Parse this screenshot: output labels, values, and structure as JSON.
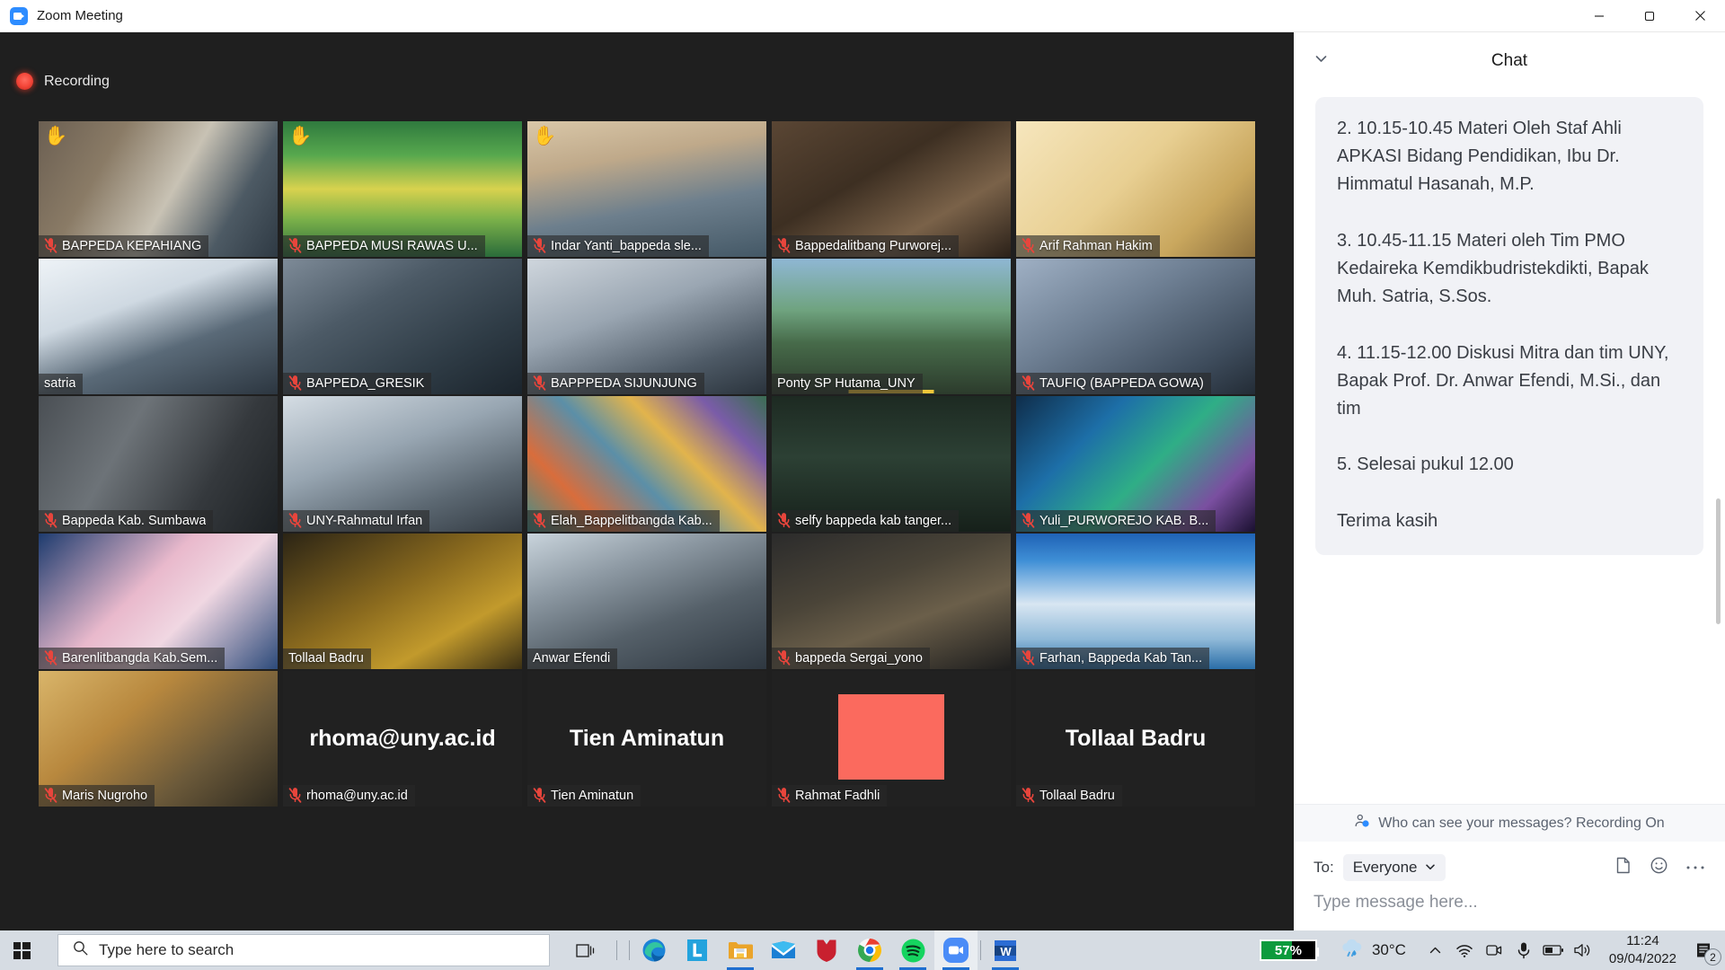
{
  "window": {
    "title": "Zoom Meeting",
    "app_icon": "zoom-camera-icon",
    "minimize_label": "─",
    "maximize_label": "❐",
    "close_label": "✕"
  },
  "meeting": {
    "recording_label": "Recording",
    "participants": [
      {
        "name": "BAPPEDA KEPAHIANG",
        "muted": true,
        "hand": true,
        "raised": "✋",
        "active": false,
        "speaking": false,
        "bg": "linear-gradient(120deg,#6b5f52 0%,#8a7b66 28%,#c8c2b4 55%,#4d5a64 78%,#2f3a44 100%)",
        "text": "",
        "redblock": false
      },
      {
        "name": "BAPPEDA MUSI RAWAS U...",
        "muted": true,
        "hand": true,
        "raised": "✋",
        "active": false,
        "speaking": false,
        "bg": "linear-gradient(180deg,#2f7a3e 0%,#57a84e 25%,#d8d24e 50%,#7cb24a 72%,#2a6b3a 100%)",
        "text": "",
        "redblock": false
      },
      {
        "name": "Indar Yanti_bappeda sle...",
        "muted": true,
        "hand": true,
        "raised": "✋",
        "active": false,
        "speaking": false,
        "bg": "linear-gradient(170deg,#d9c7a8 0%,#bfa98a 30%,#6d7f8d 62%,#445866 100%)",
        "text": "",
        "redblock": false
      },
      {
        "name": "Bappedalitbang Purworej...",
        "muted": true,
        "hand": false,
        "raised": "",
        "active": false,
        "speaking": false,
        "bg": "linear-gradient(150deg,#5a4634 0%,#3d2f22 40%,#7a6249 70%,#2b2119 100%)",
        "text": "",
        "redblock": false
      },
      {
        "name": "Arif Rahman Hakim",
        "muted": true,
        "hand": false,
        "raised": "",
        "active": false,
        "speaking": false,
        "bg": "linear-gradient(135deg,#f6e6bd 0%,#e8cf92 45%,#c9a75e 75%,#8c6f3c 100%)",
        "text": "",
        "redblock": false
      },
      {
        "name": "satria",
        "muted": false,
        "hand": false,
        "raised": "",
        "active": false,
        "speaking": false,
        "bg": "linear-gradient(160deg,#eef3f7 0%,#cfd9e2 35%,#5a6a78 62%,#2c3640 100%)",
        "text": "",
        "redblock": false
      },
      {
        "name": "BAPPEDA_GRESIK",
        "muted": true,
        "hand": false,
        "raised": "",
        "active": false,
        "speaking": false,
        "bg": "linear-gradient(150deg,#7e8b98 0%,#4c5a66 35%,#2f3c46 70%,#1b242c 100%)",
        "text": "",
        "redblock": false
      },
      {
        "name": "BAPPPEDA SIJUNJUNG",
        "muted": true,
        "hand": false,
        "raised": "",
        "active": false,
        "speaking": false,
        "bg": "linear-gradient(160deg,#cfd6dd 0%,#9aa6b2 40%,#4e5a66 75%,#2a333c 100%)",
        "text": "",
        "redblock": false
      },
      {
        "name": "Ponty SP Hutama_UNY",
        "muted": false,
        "hand": false,
        "raised": "",
        "active": false,
        "speaking": true,
        "bg": "linear-gradient(180deg,#8fb7d4 0%,#6fa37f 38%,#476b4a 62%,#2c3b2c 100%)",
        "text": "",
        "redblock": false
      },
      {
        "name": "TAUFIQ (BAPPEDA GOWA)",
        "muted": true,
        "hand": false,
        "raised": "",
        "active": false,
        "speaking": false,
        "bg": "linear-gradient(150deg,#9fb0c4 0%,#6e7f93 40%,#3e4c5c 78%,#232c36 100%)",
        "text": "",
        "redblock": false
      },
      {
        "name": "Bappeda Kab. Sumbawa",
        "muted": true,
        "hand": false,
        "raised": "",
        "active": false,
        "speaking": false,
        "bg": "linear-gradient(120deg,#4a4f54 0%,#6d7378 35%,#35393d 70%,#1d2124 100%)",
        "text": "",
        "redblock": false
      },
      {
        "name": "UNY-Rahmatul Irfan",
        "muted": true,
        "hand": false,
        "raised": "",
        "active": false,
        "speaking": false,
        "bg": "linear-gradient(160deg,#d5dde4 0%,#98a6b2 40%,#5c6872 72%,#333b43 100%)",
        "text": "",
        "redblock": false
      },
      {
        "name": "Elah_Bappelitbangda Kab...",
        "muted": true,
        "hand": false,
        "raised": "",
        "active": false,
        "speaking": false,
        "bg": "linear-gradient(45deg,#3f8f8a 0%,#d96d3c 22%,#5b8fa8 44%,#e2b44c 63%,#7a5ca8 82%,#3a6d52 100%)",
        "text": "",
        "redblock": false
      },
      {
        "name": "selfy bappeda kab tanger...",
        "muted": true,
        "hand": false,
        "raised": "",
        "active": false,
        "speaking": false,
        "bg": "linear-gradient(180deg,#1d2a22 0%,#2c4034 45%,#16201a 100%)",
        "text": "",
        "redblock": false
      },
      {
        "name": "Yuli_PURWOREJO KAB. B...",
        "muted": true,
        "hand": false,
        "raised": "",
        "active": false,
        "speaking": false,
        "bg": "linear-gradient(135deg,#0f2d4a 0%,#1d6fa8 30%,#2fae86 55%,#7a4fa0 80%,#1a1030 100%)",
        "text": "",
        "redblock": false
      },
      {
        "name": "Barenlitbangda Kab.Sem...",
        "muted": true,
        "hand": false,
        "raised": "",
        "active": false,
        "speaking": false,
        "bg": "linear-gradient(135deg,#1d3b6e 0%,#e9b9cc 42%,#f0d7e2 62%,#2c4a7a 100%)",
        "text": "",
        "redblock": false
      },
      {
        "name": "Tollaal Badru",
        "muted": false,
        "hand": false,
        "raised": "",
        "active": false,
        "speaking": false,
        "bg": "linear-gradient(150deg,#2b2415 0%,#8a6a1e 45%,#c29a2c 72%,#3a2f14 100%)",
        "text": "",
        "redblock": false
      },
      {
        "name": "Anwar Efendi",
        "muted": false,
        "hand": false,
        "raised": "",
        "active": true,
        "speaking": false,
        "bg": "linear-gradient(160deg,#c9d4dc 0%,#8e9aa4 30%,#556069 62%,#2e3740 100%)",
        "text": "",
        "redblock": false
      },
      {
        "name": "bappeda Sergai_yono",
        "muted": true,
        "hand": false,
        "raised": "",
        "active": false,
        "speaking": false,
        "bg": "linear-gradient(160deg,#2b2b2b 0%,#4a4438 38%,#6b5f4a 62%,#1e1e1e 100%)",
        "text": "",
        "redblock": false
      },
      {
        "name": "Farhan, Bappeda Kab Tan...",
        "muted": true,
        "hand": false,
        "raised": "",
        "active": false,
        "speaking": false,
        "bg": "linear-gradient(180deg,#1f62b5 0%,#3f8fd6 20%,#d8e6f2 52%,#8fb9d8 78%,#2a6ea8 100%)",
        "text": "",
        "redblock": false
      },
      {
        "name": "Maris Nugroho",
        "muted": true,
        "hand": false,
        "raised": "",
        "active": false,
        "speaking": false,
        "bg": "linear-gradient(140deg,#d9b56a 0%,#b8883e 35%,#6c5a3a 68%,#2e2a20 100%)",
        "text": "",
        "redblock": false
      },
      {
        "name": "rhoma@uny.ac.id",
        "muted": true,
        "hand": false,
        "raised": "",
        "active": false,
        "speaking": false,
        "bg": "#212121",
        "text": "rhoma@uny.ac.id",
        "redblock": false
      },
      {
        "name": "Tien Aminatun",
        "muted": true,
        "hand": false,
        "raised": "",
        "active": false,
        "speaking": false,
        "bg": "#212121",
        "text": "Tien Aminatun",
        "redblock": false
      },
      {
        "name": "Rahmat Fadhli",
        "muted": true,
        "hand": false,
        "raised": "",
        "active": false,
        "speaking": false,
        "bg": "#212121",
        "text": "",
        "redblock": true
      },
      {
        "name": "Tollaal Badru",
        "muted": true,
        "hand": false,
        "raised": "",
        "active": false,
        "speaking": false,
        "bg": "#212121",
        "text": "Tollaal Badru",
        "redblock": false
      }
    ]
  },
  "chat": {
    "title": "Chat",
    "collapse_icon": "chevron-down-icon",
    "messages": [
      {
        "text": "2. 10.15-10.45 Materi Oleh Staf Ahli APKASI Bidang Pendidikan, Ibu Dr. Himmatul Hasanah, M.P.\n\n3. 10.45-11.15 Materi oleh Tim PMO Kedaireka Kemdikbudristekdikti, Bapak Muh. Satria, S.Sos.\n\n4. 11.15-12.00 Diskusi Mitra dan tim UNY, Bapak Prof. Dr. Anwar Efendi, M.Si., dan tim\n\n5. Selesai pukul 12.00\n\nTerima kasih"
      }
    ],
    "privacy_notice": "Who can see your messages? Recording On",
    "privacy_icon": "person-shield-icon",
    "to_label": "To:",
    "to_value": "Everyone",
    "file_icon": "file-icon",
    "emoji_icon": "smiley-icon",
    "more_icon": "ellipsis-icon",
    "input_placeholder": "Type message here..."
  },
  "taskbar": {
    "start_label": "start-button",
    "search_placeholder": "Type here to search",
    "search_icon": "search-icon",
    "apps": [
      {
        "name": "task-view-icon",
        "running": false,
        "active": false
      },
      {
        "name": "edge-icon",
        "running": false,
        "active": false
      },
      {
        "name": "lenovo-icon",
        "running": false,
        "active": false
      },
      {
        "name": "file-explorer-icon",
        "running": true,
        "active": false
      },
      {
        "name": "mail-icon",
        "running": false,
        "active": false
      },
      {
        "name": "mcafee-icon",
        "running": false,
        "active": false
      },
      {
        "name": "chrome-icon",
        "running": true,
        "active": false
      },
      {
        "name": "spotify-icon",
        "running": true,
        "active": false
      },
      {
        "name": "zoom-icon",
        "running": true,
        "active": true
      },
      {
        "name": "word-icon",
        "running": true,
        "active": false
      }
    ],
    "battery_percent": "57%",
    "battery_level": 57,
    "weather_icon": "rain-cloud-icon",
    "temperature": "30°C",
    "tray_overflow_icon": "chevron-up-icon",
    "wifi_icon": "wifi-icon",
    "camera_icon": "camera-icon",
    "mic_icon": "microphone-icon",
    "battery_icon": "battery-icon",
    "volume_icon": "speaker-icon",
    "time": "11:24",
    "date": "09/04/2022",
    "notification_icon": "notifications-icon",
    "notification_count": "2"
  },
  "colors": {
    "zoom_blue": "#2d8cff",
    "active_speaker": "#d9e92b",
    "speaking_bar": "#f0c63a",
    "recording_red": "#f5483b",
    "battery_green": "#0d9b3d",
    "taskbar_bg": "#d6dce3",
    "chat_bubble": "#f1f2f6"
  }
}
